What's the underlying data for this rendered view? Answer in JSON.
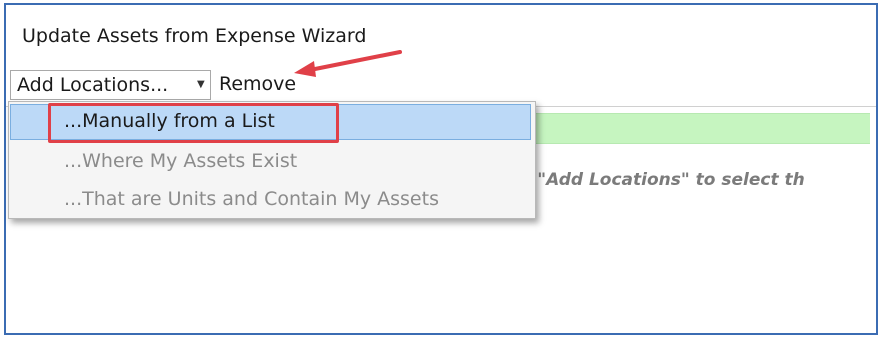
{
  "window": {
    "title": "Update Assets from Expense Wizard"
  },
  "toolbar": {
    "add_locations_label": "Add Locations...",
    "remove_label": "Remove"
  },
  "dropdown": {
    "items": [
      {
        "label": "...Manually from a List",
        "state": "highlighted"
      },
      {
        "label": "...Where My Assets Exist",
        "state": "disabled"
      },
      {
        "label": "...That are Units and Contain My Assets",
        "state": "disabled"
      }
    ]
  },
  "content": {
    "hint_text": "k \"Add Locations\" to select th"
  },
  "colors": {
    "accent_border": "#3b6cb3",
    "highlight_red": "#e04048",
    "selected_item": "#bcd9f7",
    "green_row": "#c6f5c0"
  },
  "icons": [
    "chevron-down-icon",
    "annotation-arrow-icon"
  ]
}
